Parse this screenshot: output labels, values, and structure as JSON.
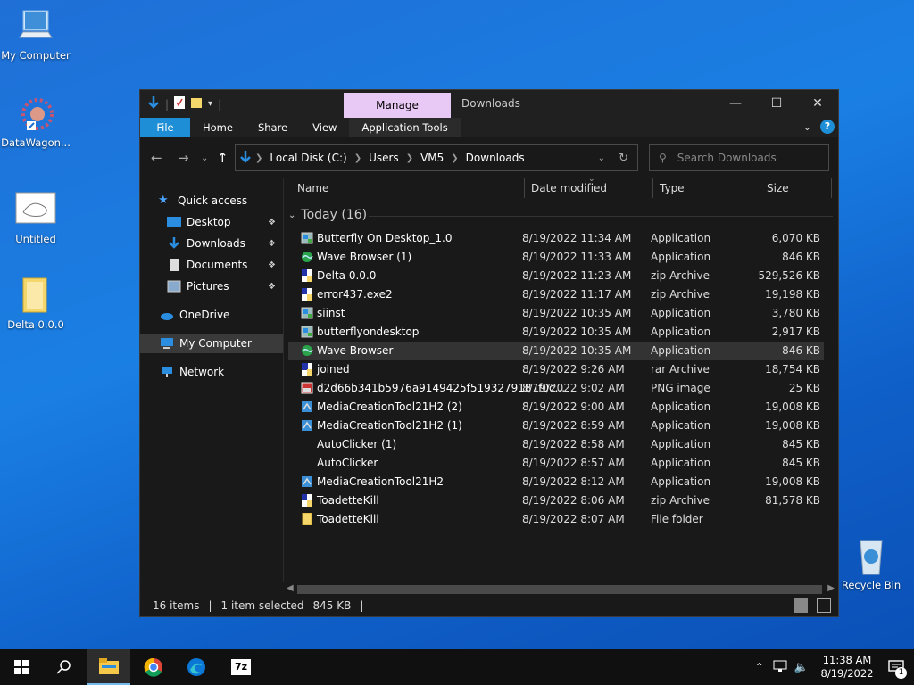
{
  "desktop": {
    "icons": [
      {
        "label": "My Computer",
        "icon": "computer-icon"
      },
      {
        "label": "DataWagon...",
        "icon": "datawagon-shortcut-icon"
      },
      {
        "label": "Untitled",
        "icon": "untitled-image-icon"
      },
      {
        "label": "Delta 0.0.0",
        "icon": "folder-icon"
      },
      {
        "label": "Recycle Bin",
        "icon": "recycle-bin-icon"
      }
    ]
  },
  "window": {
    "manage_tab": "Manage",
    "title": "Downloads",
    "ribbon_tabs": [
      "File",
      "Home",
      "Share",
      "View",
      "Application Tools"
    ],
    "help": "?",
    "breadcrumb": [
      "Local Disk (C:)",
      "Users",
      "VM5",
      "Downloads"
    ],
    "search_placeholder": "Search Downloads",
    "nav": {
      "quick_access": "Quick access",
      "items": [
        "Desktop",
        "Downloads",
        "Documents",
        "Pictures"
      ],
      "onedrive": "OneDrive",
      "my_computer": "My Computer",
      "network": "Network"
    },
    "columns": [
      "Name",
      "Date modified",
      "Type",
      "Size"
    ],
    "group": "Today (16)",
    "files": [
      {
        "name": "Butterfly On Desktop_1.0",
        "date": "8/19/2022 11:34 AM",
        "type": "Application",
        "size": "6,070 KB",
        "icon": "app-icon"
      },
      {
        "name": "Wave Browser (1)",
        "date": "8/19/2022 11:33 AM",
        "type": "Application",
        "size": "846 KB",
        "icon": "wave-icon"
      },
      {
        "name": "Delta 0.0.0",
        "date": "8/19/2022 11:23 AM",
        "type": "zip Archive",
        "size": "529,526 KB",
        "icon": "zip-icon"
      },
      {
        "name": "error437.exe2",
        "date": "8/19/2022 11:17 AM",
        "type": "zip Archive",
        "size": "19,198 KB",
        "icon": "zip-icon"
      },
      {
        "name": "siinst",
        "date": "8/19/2022 10:35 AM",
        "type": "Application",
        "size": "3,780 KB",
        "icon": "app-icon"
      },
      {
        "name": "butterflyondesktop",
        "date": "8/19/2022 10:35 AM",
        "type": "Application",
        "size": "2,917 KB",
        "icon": "app-icon"
      },
      {
        "name": "Wave Browser",
        "date": "8/19/2022 10:35 AM",
        "type": "Application",
        "size": "846 KB",
        "icon": "wave-icon"
      },
      {
        "name": "joined",
        "date": "8/19/2022 9:26 AM",
        "type": "rar Archive",
        "size": "18,754 KB",
        "icon": "rar-icon"
      },
      {
        "name": "d2d66b341b5976a9149425f5193279187f0c...",
        "date": "8/19/2022 9:02 AM",
        "type": "PNG image",
        "size": "25 KB",
        "icon": "png-icon"
      },
      {
        "name": "MediaCreationTool21H2 (2)",
        "date": "8/19/2022 9:00 AM",
        "type": "Application",
        "size": "19,008 KB",
        "icon": "media-tool-icon"
      },
      {
        "name": "MediaCreationTool21H2 (1)",
        "date": "8/19/2022 8:59 AM",
        "type": "Application",
        "size": "19,008 KB",
        "icon": "media-tool-icon"
      },
      {
        "name": "AutoClicker (1)",
        "date": "8/19/2022 8:58 AM",
        "type": "Application",
        "size": "845 KB",
        "icon": "blank-icon"
      },
      {
        "name": "AutoClicker",
        "date": "8/19/2022 8:57 AM",
        "type": "Application",
        "size": "845 KB",
        "icon": "blank-icon"
      },
      {
        "name": "MediaCreationTool21H2",
        "date": "8/19/2022 8:12 AM",
        "type": "Application",
        "size": "19,008 KB",
        "icon": "media-tool-icon"
      },
      {
        "name": "ToadetteKill",
        "date": "8/19/2022 8:06 AM",
        "type": "zip Archive",
        "size": "81,578 KB",
        "icon": "zip-icon"
      },
      {
        "name": "ToadetteKill",
        "date": "8/19/2022 8:07 AM",
        "type": "File folder",
        "size": "",
        "icon": "folder-icon"
      }
    ],
    "selected_index": 6,
    "status": {
      "items": "16 items",
      "selected": "1 item selected",
      "size": "845 KB",
      "bar": "|"
    }
  },
  "taskbar": {
    "time": "11:38 AM",
    "date": "8/19/2022",
    "notification_count": "1",
    "apps": [
      "start-icon",
      "search-icon",
      "file-explorer-icon",
      "chrome-icon",
      "edge-icon",
      "7zip-icon"
    ],
    "sevenzip_label": "7z"
  },
  "colors": {
    "accent": "#1e8fd6",
    "manage": "#e8c8f4"
  }
}
